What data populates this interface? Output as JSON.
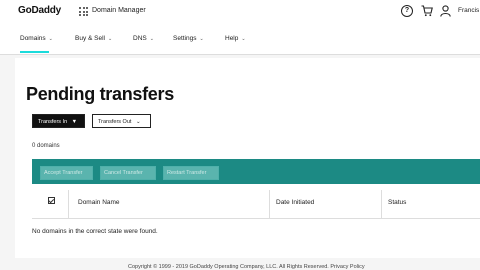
{
  "header": {
    "logo": "GoDaddy",
    "app_name": "Domain Manager",
    "user_name": "Francis"
  },
  "nav": {
    "items": [
      {
        "label": "Domains"
      },
      {
        "label": "Buy & Sell"
      },
      {
        "label": "DNS"
      },
      {
        "label": "Settings"
      },
      {
        "label": "Help"
      }
    ]
  },
  "page": {
    "title": "Pending transfers",
    "tab_in": "Transfers In",
    "tab_out": "Transfers Out",
    "count": "0 domains"
  },
  "actions": {
    "accept": "Accept Transfer",
    "cancel": "Cancel Transfer",
    "restart": "Restart Transfer"
  },
  "table": {
    "columns": [
      "Domain Name",
      "Date Initiated",
      "Status"
    ],
    "empty_message": "No domains in the correct state were found."
  },
  "footer": {
    "text": "Copyright © 1999 - 2019 GoDaddy Operating Company, LLC. All Rights Reserved. Privacy Policy"
  },
  "colors": {
    "accent": "#1bdbdb",
    "action_bar": "#1c8a84"
  }
}
